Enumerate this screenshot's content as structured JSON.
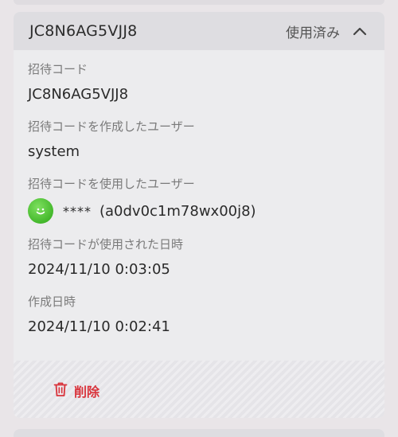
{
  "card": {
    "title": "JC8N6AG5VJJ8",
    "status": "使用済み",
    "expand_icon": "chevron-up-icon"
  },
  "fields": {
    "invite_code_label": "招待コード",
    "invite_code_value": "JC8N6AG5VJJ8",
    "creator_label": "招待コードを作成したユーザー",
    "creator_value": "system",
    "user_label": "招待コードを使用したユーザー",
    "user_name": "****",
    "user_id": "(a0dv0c1m78wx00j8)",
    "used_at_label": "招待コードが使用された日時",
    "used_at_value": "2024/11/10 0:03:05",
    "created_at_label": "作成日時",
    "created_at_value": "2024/11/10 0:02:41"
  },
  "actions": {
    "delete_label": "削除",
    "delete_icon": "trash-icon"
  },
  "colors": {
    "danger": "#d9333b",
    "avatar": "#44b82c"
  }
}
